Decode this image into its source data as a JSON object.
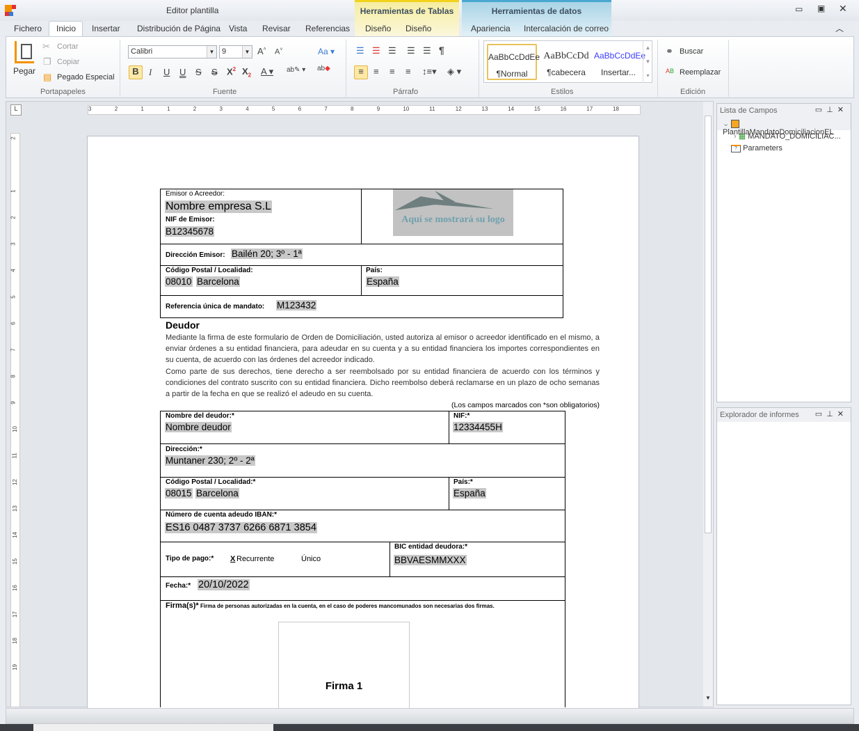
{
  "window": {
    "title": "Editor plantilla",
    "context_tabs": [
      "Herramientas de Tablas",
      "Herramientas de datos"
    ]
  },
  "tabs": [
    "Fichero",
    "Inicio",
    "Insertar",
    "Distribución de Página",
    "Vista",
    "Revisar",
    "Referencias",
    "Diseño",
    "Diseño",
    "Apariencia",
    "Intercalación de correo"
  ],
  "ribbon": {
    "clipboard": {
      "paste": "Pegar",
      "cut": "Cortar",
      "copy": "Copiar",
      "paste_special": "Pegado Especial",
      "label": "Portapapeles"
    },
    "font": {
      "name": "Calibri",
      "size": "9",
      "label": "Fuente",
      "case": "Aa"
    },
    "paragraph": {
      "label": "Párrafo"
    },
    "styles": {
      "label": "Estilos",
      "items": [
        {
          "sample": "AaBbCcDdEe",
          "name": "¶Normal"
        },
        {
          "sample": "AaBbCcDd",
          "name": "¶cabecera"
        },
        {
          "sample": "AaBbCcDdEe",
          "name": "Insertar..."
        }
      ]
    },
    "editing": {
      "label": "Edición",
      "find": "Buscar",
      "replace": "Reemplazar"
    }
  },
  "rulers": {
    "horizontal": [
      "3",
      "2",
      "1",
      "1",
      "2",
      "3",
      "4",
      "5",
      "6",
      "7",
      "8",
      "9",
      "10",
      "11",
      "12",
      "13",
      "14",
      "15",
      "16",
      "17",
      "18"
    ],
    "vertical": [
      "2",
      "1",
      "2",
      "3",
      "4",
      "5",
      "6",
      "7",
      "8",
      "9",
      "10",
      "11",
      "12",
      "13",
      "14",
      "15",
      "16",
      "17",
      "18",
      "19"
    ]
  },
  "document": {
    "creditor": {
      "label": "Emisor o Acreedor:",
      "name": "Nombre empresa S.L",
      "nif_label": "NIF de Emisor:",
      "nif": "B12345678",
      "logo_text": "Aquí se mostrará su logo",
      "address_label": "Dirección Emisor:",
      "address": "Bailén 20; 3º - 1ª",
      "postal_label": "Código Postal / Localidad:",
      "postal": "08010",
      "city": "Barcelona",
      "country_label": "País:",
      "country": "España",
      "ref_label": "Referencia única de mandato:",
      "ref": "M123432"
    },
    "debtor_heading": "Deudor",
    "paragraph1": "Mediante la firma de este formulario de Orden de Domiciliación, usted autoriza al emisor o acreedor identificado en el mismo, a enviar órdenes a su entidad financiera, para adeudar en su cuenta y a su entidad financiera los importes correspondientes en su cuenta, de acuerdo con las órdenes del acreedor indicado.",
    "paragraph2": "Como parte de sus derechos, tiene derecho a ser reembolsado por su entidad financiera de acuerdo con los términos y condiciones del contrato suscrito con su entidad financiera. Dicho reembolso deberá reclamarse en un plazo de ocho semanas a partir de la fecha en que se realizó el adeudo en su cuenta.",
    "required_note": "(Los campos marcados con *son obligatorios)",
    "debtor": {
      "name_label": "Nombre del deudor:*",
      "name": "Nombre deudor",
      "nif_label": "NIF:*",
      "nif": "12334455H",
      "address_label": "Dirección:*",
      "address": "Muntaner 230; 2º - 2ª",
      "postal_label": "Código Postal / Localidad:*",
      "postal": "08015",
      "city": "Barcelona",
      "country_label": "País:*",
      "country": "España",
      "iban_label": "Número de cuenta adeudo IBAN:*",
      "iban": "ES16 0487 3737 6266 6871 3854",
      "payment_label": "Tipo de pago:*",
      "payment_mark": "X",
      "recurring": "Recurrente",
      "single": "Único",
      "bic_label": "BIC entidad deudora:*",
      "bic": "BBVAESMMXXX",
      "date_label": "Fecha:*",
      "date": "20/10/2022",
      "sign_label": "Firma(s)*",
      "sign_note": "Firma de personas autorizadas en la cuenta, en el caso de poderes mancomunados son necesarias dos firmas.",
      "sign_box": "Firma 1"
    }
  },
  "fields_panel": {
    "title": "Lista de Campos",
    "tree": [
      "PlantillaMandatoDomiciliacionEL",
      "MANDATO_DOMICILIAC...",
      "Parameters"
    ]
  },
  "reports_panel": {
    "title": "Explorador de informes"
  }
}
